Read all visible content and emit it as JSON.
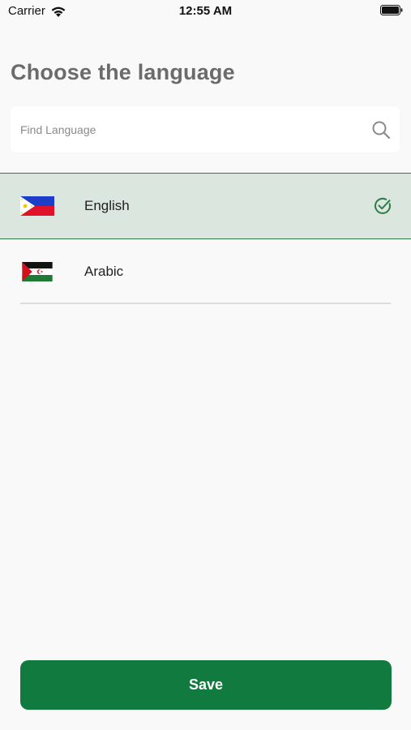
{
  "status_bar": {
    "carrier": "Carrier",
    "time": "12:55 AM",
    "wifi_icon": "wifi-icon",
    "battery_icon": "battery-icon"
  },
  "title": "Choose the language",
  "search": {
    "placeholder": "Find Language",
    "value": "",
    "icon": "search-icon"
  },
  "languages": [
    {
      "label": "English",
      "flag": "philippines-flag",
      "selected": true
    },
    {
      "label": "Arabic",
      "flag": "western-sahara-flag",
      "selected": false
    }
  ],
  "selected_icon": "check-circle-icon",
  "save_label": "Save",
  "colors": {
    "accent": "#107a3f",
    "selected_bg": "#dbe6de",
    "selected_border": "#2e7d48",
    "title": "#6b6b6b",
    "background": "#f9f9f9"
  }
}
